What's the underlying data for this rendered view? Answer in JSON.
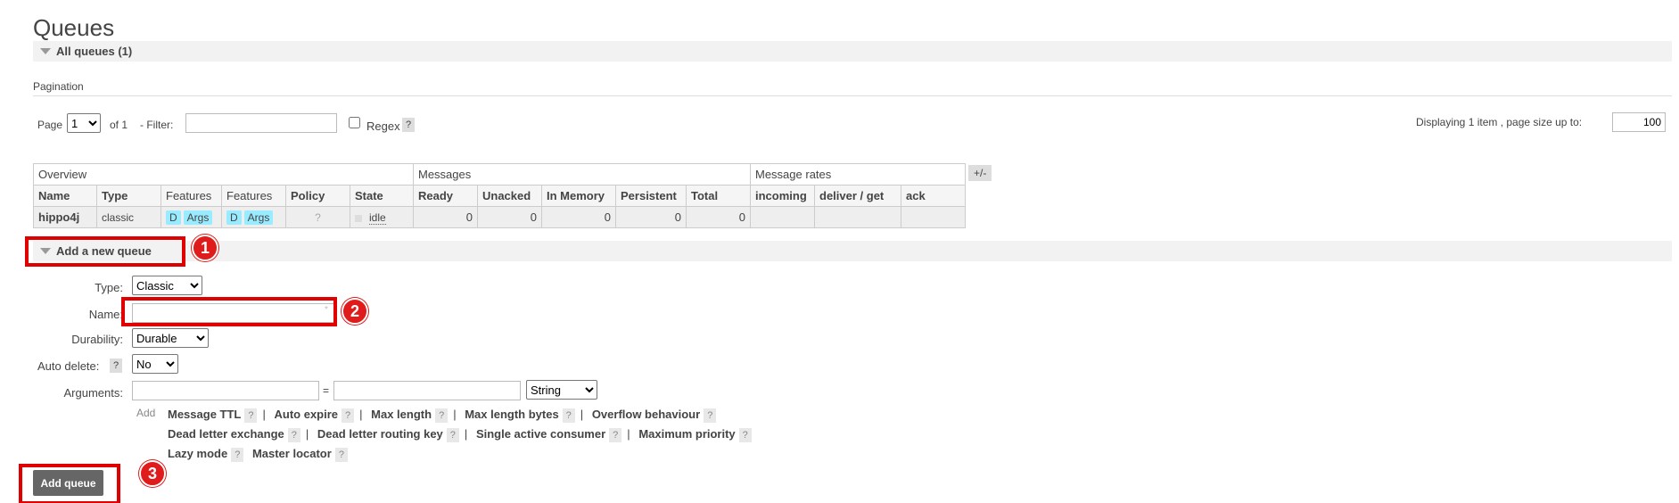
{
  "page": {
    "title": "Queues"
  },
  "all_queues": {
    "label": "All queues (1)"
  },
  "pagination": {
    "heading": "Pagination",
    "page_label": "Page",
    "page_value": "1",
    "of_label": "of 1",
    "filter_label": "- Filter:",
    "filter_value": "",
    "regex_label": "Regex",
    "help": "?",
    "displaying": "Displaying 1 item , page size up to:",
    "page_size": "100"
  },
  "table": {
    "groups": [
      "Overview",
      "Messages",
      "Message rates"
    ],
    "columns": [
      "Name",
      "Type",
      "Features",
      "Features",
      "Policy",
      "State",
      "Ready",
      "Unacked",
      "In Memory",
      "Persistent",
      "Total",
      "incoming",
      "deliver / get",
      "ack"
    ],
    "row": {
      "name": "hippo4j",
      "type": "classic",
      "features1": [
        "D",
        "Args"
      ],
      "features2": [
        "D",
        "Args"
      ],
      "policy": "?",
      "state": "idle",
      "ready": "0",
      "unacked": "0",
      "in_memory": "0",
      "persistent": "0",
      "total": "0",
      "incoming": "",
      "deliver_get": "",
      "ack": ""
    },
    "toggle": "+/-"
  },
  "add_queue": {
    "label": "Add a new queue",
    "type_label": "Type:",
    "type_value": "Classic",
    "name_label": "Name:",
    "name_value": "",
    "required_mark": "*",
    "durability_label": "Durability:",
    "durability_value": "Durable",
    "auto_delete_label": "Auto delete:",
    "auto_delete_help": "?",
    "auto_delete_value": "No",
    "arguments_label": "Arguments:",
    "arguments_eq": "=",
    "arguments_type": "String",
    "add_label": "Add",
    "arg_line1": [
      "Message TTL",
      "Auto expire",
      "Max length",
      "Max length bytes",
      "Overflow behaviour"
    ],
    "arg_line2": [
      "Dead letter exchange",
      "Dead letter routing key",
      "Single active consumer",
      "Maximum priority"
    ],
    "arg_line3": [
      "Lazy mode",
      "Master locator"
    ],
    "help": "?",
    "separator": "|",
    "submit": "Add queue"
  },
  "annotations": {
    "one": "1",
    "two": "2",
    "three": "3"
  },
  "colors": {
    "highlight": "#e00000",
    "feature_tag": "#99ebff",
    "section_bar": "#f2f2f2"
  }
}
